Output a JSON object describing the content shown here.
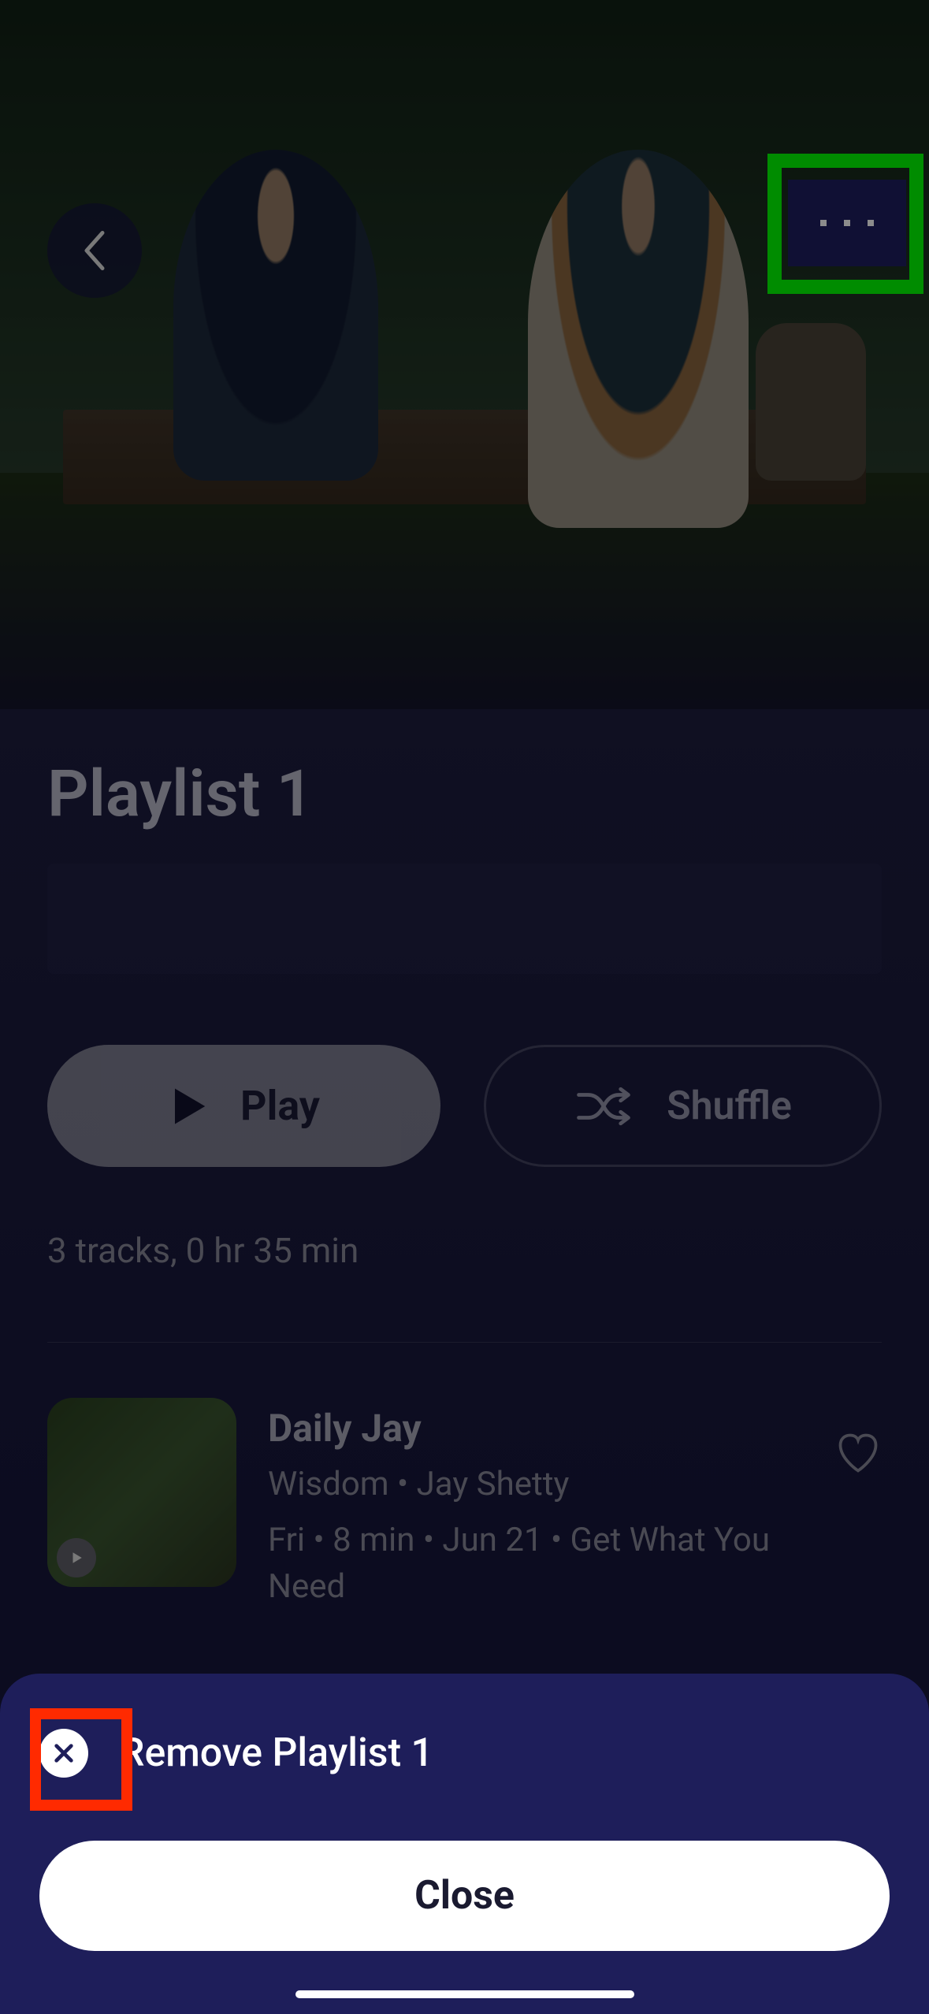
{
  "header": {
    "back_label": "back",
    "more_label": "more"
  },
  "playlist": {
    "title": "Playlist 1",
    "play_label": "Play",
    "shuffle_label": "Shuffle",
    "track_info": "3 tracks, 0 hr 35 min"
  },
  "tracks": [
    {
      "title": "Daily Jay",
      "subtitle": "Wisdom • Jay Shetty",
      "meta": "Fri • 8 min • Jun 21 • Get What You Need"
    }
  ],
  "sheet": {
    "remove_label": "Remove Playlist 1",
    "close_label": "Close"
  }
}
